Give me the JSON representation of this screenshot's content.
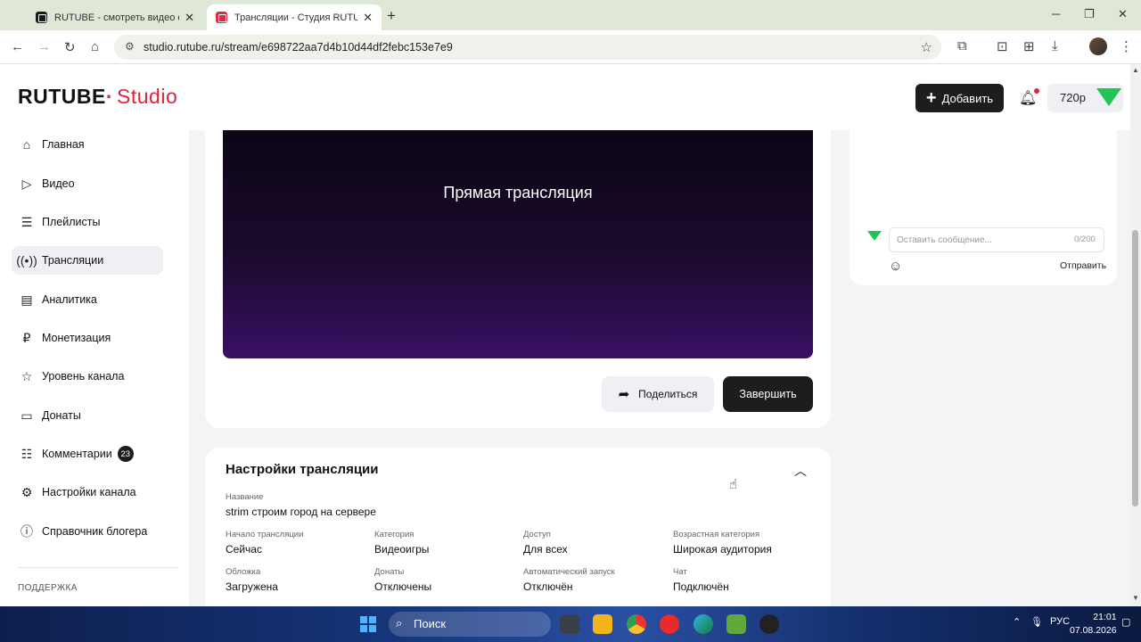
{
  "browser": {
    "tabs": [
      {
        "title": "RUTUBE - смотреть видео онл"
      },
      {
        "title": "Трансляции - Студия RUTUBE"
      }
    ],
    "url": "studio.rutube.ru/stream/e698722aa7d4b10d44df2febc153e7e9"
  },
  "header": {
    "logo_main": "RUTUBE",
    "logo_studio": "Studio",
    "add_label": "Добавить",
    "quality": "720p"
  },
  "sidebar": {
    "items": [
      {
        "label": "Главная"
      },
      {
        "label": "Видео"
      },
      {
        "label": "Плейлисты"
      },
      {
        "label": "Трансляции"
      },
      {
        "label": "Аналитика"
      },
      {
        "label": "Монетизация"
      },
      {
        "label": "Уровень канала"
      },
      {
        "label": "Донаты"
      },
      {
        "label": "Комментарии",
        "badge": "23"
      },
      {
        "label": "Настройки канала"
      },
      {
        "label": "Справочник блогера"
      }
    ],
    "support": "ПОДДЕРЖКА"
  },
  "player": {
    "live_text": "Прямая трансляция",
    "share_label": "Поделиться",
    "end_label": "Завершить"
  },
  "settings": {
    "title": "Настройки трансляции",
    "name_label": "Название",
    "name_value": "strim строим город на сервере",
    "fields": [
      {
        "label": "Начало трансляции",
        "value": "Сейчас"
      },
      {
        "label": "Категория",
        "value": "Видеоигры"
      },
      {
        "label": "Доступ",
        "value": "Для всех"
      },
      {
        "label": "Возрастная категория",
        "value": "Широкая аудитория"
      },
      {
        "label": "Обложка",
        "value": "Загружена"
      },
      {
        "label": "Донаты",
        "value": "Отключены"
      },
      {
        "label": "Автоматический запуск",
        "value": "Отключён"
      },
      {
        "label": "Чат",
        "value": "Подключён"
      }
    ]
  },
  "chat": {
    "placeholder": "Оставить сообщение...",
    "counter": "0/200",
    "send_label": "Отправить"
  },
  "taskbar": {
    "search": "Поиск",
    "lang": "РУС",
    "time": "21:01",
    "date": "07.08.2026"
  }
}
